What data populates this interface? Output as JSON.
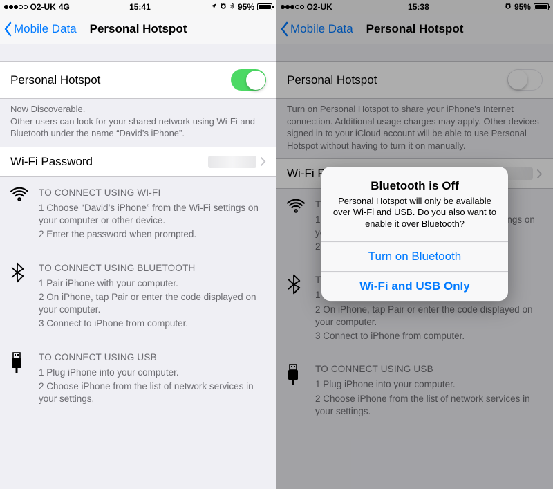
{
  "left": {
    "status": {
      "carrier": "O2-UK",
      "net": "4G",
      "time": "15:41",
      "battery": "95%"
    },
    "nav": {
      "back": "Mobile Data",
      "title": "Personal Hotspot"
    },
    "hotspot_row": {
      "label": "Personal Hotspot",
      "on": true
    },
    "footer1_line1": "Now Discoverable.",
    "footer1_line2": "Other users can look for your shared network using Wi-Fi and Bluetooth under the name “David’s iPhone”.",
    "wifi_row": {
      "label": "Wi-Fi Password"
    },
    "instr_wifi": {
      "head": "TO CONNECT USING WI-FI",
      "s1": "1 Choose “David’s iPhone” from the Wi-Fi settings on your computer or other device.",
      "s2": "2 Enter the password when prompted."
    },
    "instr_bt": {
      "head": "TO CONNECT USING BLUETOOTH",
      "s1": "1 Pair iPhone with your computer.",
      "s2": "2 On iPhone, tap Pair or enter the code displayed on your computer.",
      "s3": "3 Connect to iPhone from computer."
    },
    "instr_usb": {
      "head": "TO CONNECT USING USB",
      "s1": "1 Plug iPhone into your computer.",
      "s2": "2 Choose iPhone from the list of network services in your settings."
    }
  },
  "right": {
    "status": {
      "carrier": "O2-UK",
      "time": "15:38",
      "battery": "95%"
    },
    "nav": {
      "back": "Mobile Data",
      "title": "Personal Hotspot"
    },
    "hotspot_row": {
      "label": "Personal Hotspot",
      "on": false
    },
    "footer1": "Turn on Personal Hotspot to share your iPhone's Internet connection. Additional usage charges may apply. Other devices signed in to your iCloud account will be able to use Personal Hotspot without having to turn it on manually.",
    "wifi_row": {
      "label": "Wi-Fi Password"
    },
    "instr_wifi": {
      "head": "TO CONNECT USING WI-FI",
      "s1": "1 Choose “David’s iPhone” from the Wi-Fi settings on your computer or other device.",
      "s2": "2 Enter the password when prompted."
    },
    "instr_bt": {
      "head": "TO CONNECT USING BLUETOOTH",
      "s1": "1 Pair iPhone with your computer.",
      "s2": "2 On iPhone, tap Pair or enter the code displayed on your computer.",
      "s3": "3 Connect to iPhone from computer."
    },
    "instr_usb": {
      "head": "TO CONNECT USING USB",
      "s1": "1 Plug iPhone into your computer.",
      "s2": "2 Choose iPhone from the list of network services in your settings."
    },
    "alert": {
      "title": "Bluetooth is Off",
      "message": "Personal Hotspot will only be available over Wi-Fi and USB. Do you also want to enable it over Bluetooth?",
      "btn1": "Turn on Bluetooth",
      "btn2": "Wi-Fi and USB Only"
    }
  }
}
